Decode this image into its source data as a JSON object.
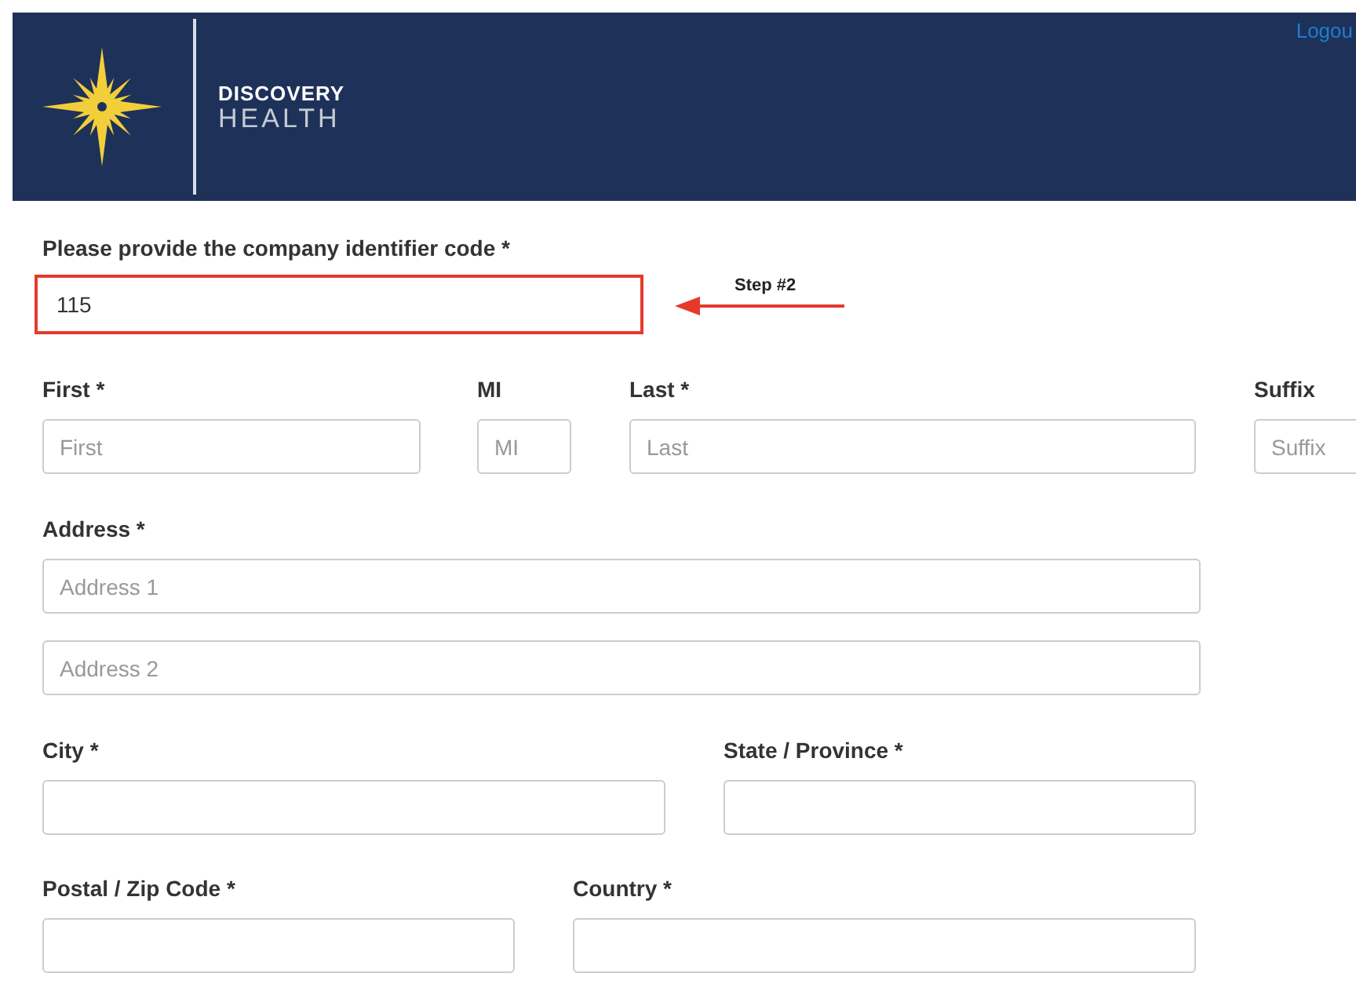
{
  "header": {
    "brand_line1": "DISCOVERY",
    "brand_line2": "HEALTH",
    "logout": "Logou"
  },
  "company_code": {
    "label": "Please provide the company identifier code *",
    "value": "115",
    "highlighted": true
  },
  "annotation": {
    "text": "Step #2"
  },
  "rows": [
    [
      {
        "label": "First *",
        "placeholder": "First"
      },
      {
        "label": "MI",
        "placeholder": "MI"
      },
      {
        "label": "Last *",
        "placeholder": "Last"
      },
      {
        "label": "Suffix",
        "placeholder": "Suffix"
      }
    ],
    [
      {
        "label": "Address *",
        "placeholder": "Address 1"
      }
    ],
    [
      {
        "placeholder": "Address 2"
      }
    ],
    [
      {
        "label": "City *"
      },
      {
        "label": "State / Province *"
      }
    ],
    [
      {
        "label": "Postal / Zip Code *"
      },
      {
        "label": "Country *"
      }
    ]
  ]
}
